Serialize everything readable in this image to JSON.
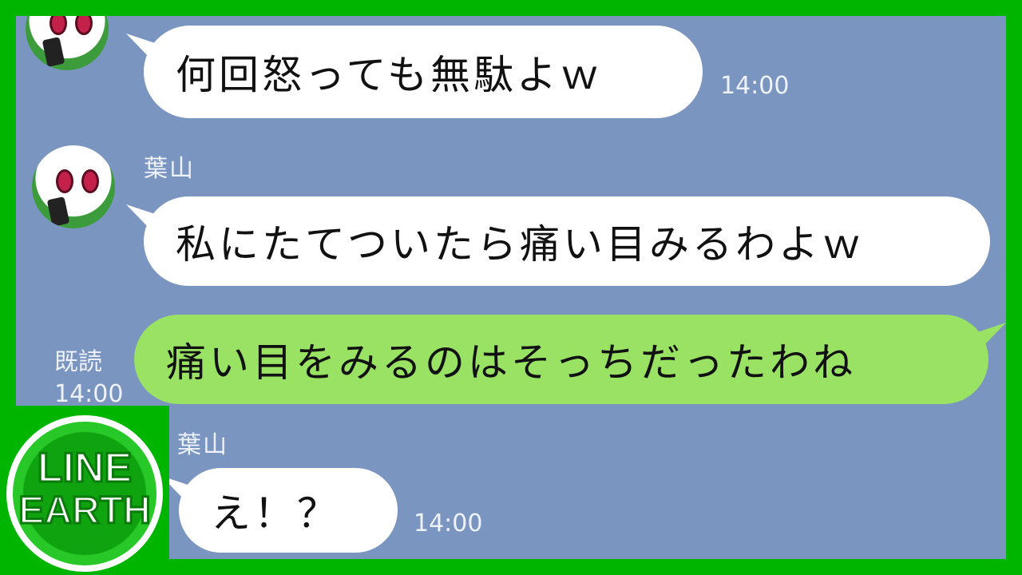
{
  "messages": [
    {
      "sender": "",
      "text": "何回怒っても無駄よｗ",
      "time": "14:00",
      "direction": "in"
    },
    {
      "sender": "葉山",
      "text": "私にたてついたら痛い目みるわよｗ",
      "time": "",
      "direction": "in"
    },
    {
      "sender": "",
      "text": "痛い目をみるのはそっちだったわね",
      "read_label": "既読",
      "time": "14:00",
      "direction": "out"
    },
    {
      "sender": "葉山",
      "text": "え！？",
      "time": "14:00",
      "direction": "in"
    }
  ],
  "logo": {
    "line1": "LINE",
    "line2": "EARTH"
  },
  "colors": {
    "frame": "#00b500",
    "chat_bg": "#7b95c1",
    "incoming": "#ffffff",
    "outgoing": "#99e264"
  }
}
